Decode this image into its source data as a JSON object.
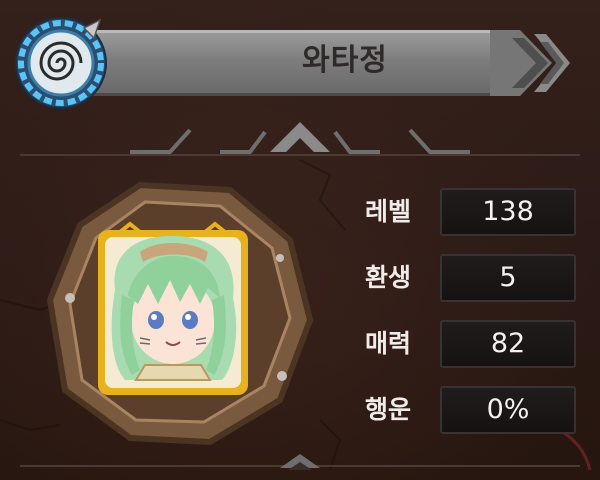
{
  "header": {
    "character_name": "와타정",
    "emblem_icon": "spiral-shell-emblem-icon"
  },
  "portrait": {
    "icon": "character-portrait-icon",
    "frame": "wooden-octagon-frame"
  },
  "stats": [
    {
      "label": "레벨",
      "value": "138"
    },
    {
      "label": "환생",
      "value": "5"
    },
    {
      "label": "매력",
      "value": "82"
    },
    {
      "label": "행운",
      "value": "0%"
    }
  ],
  "colors": {
    "background": "#2c1b17",
    "title_plate": "#8a8a8a",
    "emblem_blue": "#4fb6f0",
    "frame_wood": "#8a6a4a",
    "frame_gold": "#e8b21e"
  }
}
